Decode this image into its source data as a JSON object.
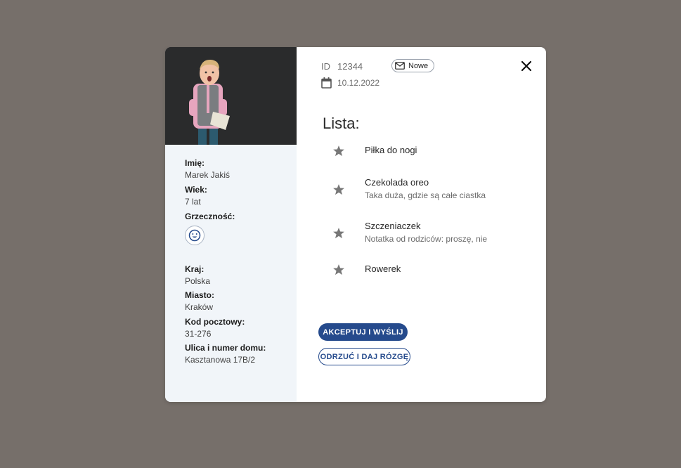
{
  "child": {
    "fields": [
      {
        "label": "Imię:",
        "value": "Marek Jakiś"
      },
      {
        "label": "Wiek:",
        "value": "7 lat"
      },
      {
        "label": "Grzeczność:",
        "icon": "smiley-icon"
      }
    ],
    "address": [
      {
        "label": "Kraj:",
        "value": "Polska"
      },
      {
        "label": "Miasto:",
        "value": "Kraków"
      },
      {
        "label": "Kod pocztowy:",
        "value": "31-276"
      },
      {
        "label": "Ulica i numer domu:",
        "value": "Kasztanowa 17B/2"
      }
    ]
  },
  "header": {
    "id_label": "ID",
    "id_value": "12344",
    "badge_label": "Nowe",
    "date": "10.12.2022"
  },
  "list": {
    "title": "Lista:",
    "items": [
      {
        "title": "Piłka do nogi",
        "note": ""
      },
      {
        "title": "Czekolada oreo",
        "note": "Taka duża, gdzie są całe ciastka"
      },
      {
        "title": "Szczeniaczek",
        "note": "Notatka od rodziców: proszę, nie"
      },
      {
        "title": "Rowerek",
        "note": ""
      }
    ]
  },
  "actions": {
    "accept_label": "AKCEPTUJ I WYŚLIJ",
    "reject_label": "ODRZUĆ I DAJ RÓZGĘ"
  },
  "colors": {
    "backdrop": "#766f6a",
    "accent": "#254a8c",
    "sidebar": "#f1f5f9"
  }
}
